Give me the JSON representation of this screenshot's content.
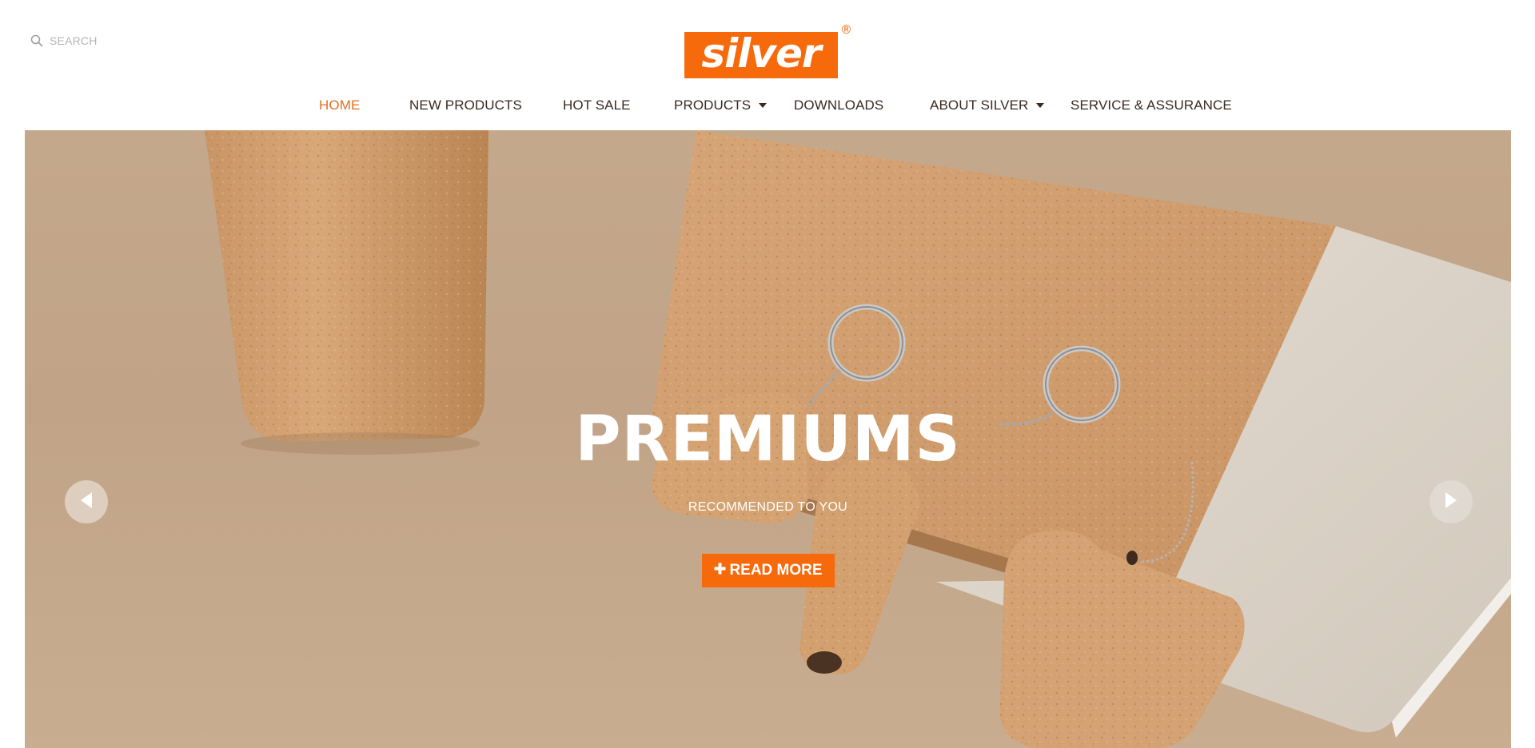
{
  "header": {
    "search_placeholder": "SEARCH",
    "logo_text": "silver",
    "logo_reg": "®"
  },
  "nav": {
    "items": [
      {
        "label": "HOME",
        "active": true,
        "dropdown": false
      },
      {
        "label": "NEW PRODUCTS",
        "active": false,
        "dropdown": false
      },
      {
        "label": "HOT SALE",
        "active": false,
        "dropdown": false
      },
      {
        "label": "PRODUCTS",
        "active": false,
        "dropdown": true
      },
      {
        "label": "DOWNLOADS",
        "active": false,
        "dropdown": false
      },
      {
        "label": "ABOUT SILVER",
        "active": false,
        "dropdown": true
      },
      {
        "label": "SERVICE & ASSURANCE",
        "active": false,
        "dropdown": false
      }
    ]
  },
  "hero": {
    "title": "PREMIUMS",
    "subtitle": "RECOMMENDED TO YOU",
    "button_icon": "plus-icon",
    "button_label": "READ MORE",
    "prev_icon": "arrow-left-icon",
    "next_icon": "arrow-right-icon"
  },
  "colors": {
    "brand": "#f76a0c",
    "nav_active": "#e46d23",
    "nav_text": "#3a2a22"
  }
}
